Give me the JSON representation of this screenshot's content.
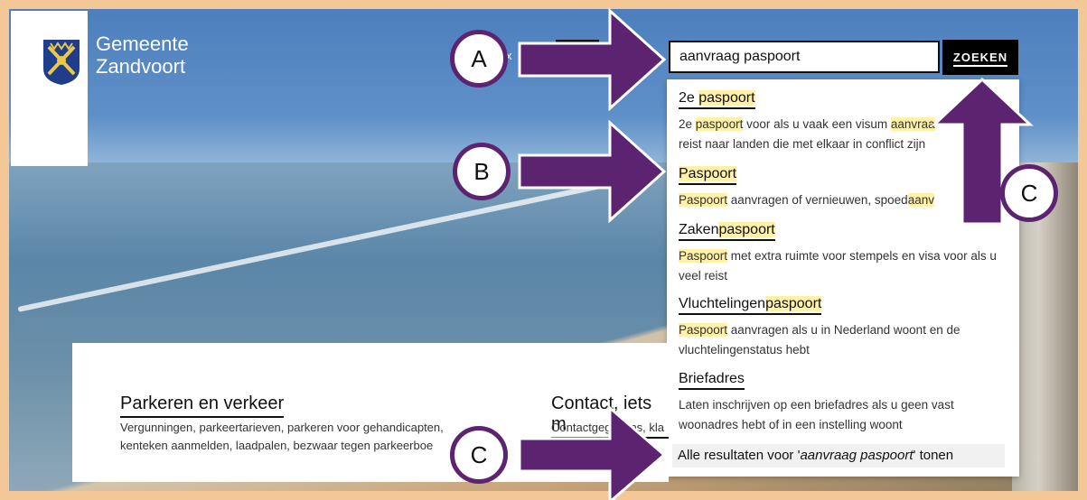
{
  "site": {
    "name_line1": "Gemeente",
    "name_line2": "Zandvoort",
    "partial_link": "x"
  },
  "search": {
    "value": "aanvraag paspoort",
    "button_label": "ZOEKEN"
  },
  "suggestions": [
    {
      "title_parts": [
        "2e ",
        "paspoort",
        ""
      ],
      "desc_parts": [
        "2e ",
        "paspoort",
        " voor als u vaak een visum ",
        "aanvraa",
        "",
        "reist naar landen die met elkaar in conflict zijn"
      ]
    },
    {
      "title_parts": [
        "",
        "Paspoort",
        ""
      ],
      "desc_parts": [
        "",
        "Paspoort",
        " aanvragen of vernieuwen, spoed",
        "aanv",
        ""
      ]
    },
    {
      "title_parts": [
        "Zaken",
        "paspoort",
        ""
      ],
      "desc_parts": [
        "",
        "Paspoort",
        " met extra ruimte voor stempels en visa voor als u veel reist"
      ]
    },
    {
      "title_parts": [
        "Vluchtelingen",
        "paspoort",
        ""
      ],
      "desc_parts": [
        "",
        "Paspoort",
        " aanvragen als u in Nederland woont en de vluchtelingenstatus hebt"
      ]
    },
    {
      "title": "Briefadres",
      "desc": "Laten inschrijven op een briefadres als u geen vast woonadres hebt of in een instelling woont"
    }
  ],
  "all_results": {
    "prefix": "Alle resultaten voor '",
    "query": "aanvraag paspoort",
    "suffix": "' tonen"
  },
  "categories": [
    {
      "title": "Parkeren en verkeer",
      "desc_line1": "Vergunningen, parkeertarieven, parkeren voor gehandicapten,",
      "desc_line2": "kenteken aanmelden, laadpalen, bezwaar tegen parkeerboe"
    },
    {
      "title": "Contact, iets m",
      "desc_line1": "Contactgegevens, kla",
      "desc_line2": ""
    }
  ],
  "annotations": {
    "a": "A",
    "b": "B",
    "c_top": "C",
    "c_bottom": "C",
    "color": "#5b2370"
  }
}
